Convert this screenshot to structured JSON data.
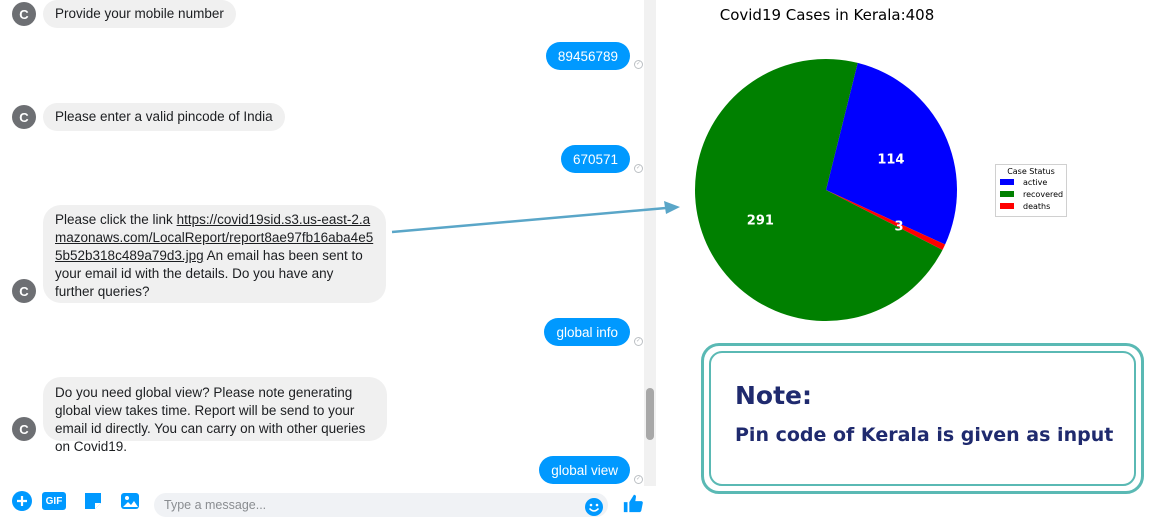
{
  "chat": {
    "avatar_letter": "C",
    "messages": [
      {
        "from": "bot",
        "text": "Provide your mobile number"
      },
      {
        "from": "user",
        "text": "89456789"
      },
      {
        "from": "bot",
        "text": "Please enter a valid pincode of India"
      },
      {
        "from": "user",
        "text": "670571"
      },
      {
        "from": "bot",
        "text_before": "Please click the link ",
        "link": "https://covid19sid.s3.us-east-2.amazonaws.com/LocalReport/report8ae97fb16aba4e55b52b318c489a79d3.jpg",
        "text_after": " An email has been sent to your email id with the details. Do you have any further queries?"
      },
      {
        "from": "user",
        "text": "global info"
      },
      {
        "from": "bot",
        "text": "Do you need global view? Please note generating global view takes time. Report will be send to your email id directly. You can carry on with other queries on Covid19."
      },
      {
        "from": "user",
        "text": "global view"
      }
    ],
    "composer": {
      "placeholder": "Type a message...",
      "gif_label": "GIF",
      "icons": [
        "plus-icon",
        "gif-icon",
        "sticker-icon",
        "image-icon",
        "emoji-icon",
        "like-icon"
      ]
    },
    "accent_color": "#0099ff"
  },
  "chart_data": {
    "type": "pie",
    "title": "Covid19 Cases in Kerala:408",
    "legend_title": "Case Status",
    "legend_placement": "right",
    "labels": [
      "active",
      "recovered",
      "deaths"
    ],
    "values": [
      114,
      291,
      3
    ],
    "colors": [
      "#0000ff",
      "#008000",
      "#ff0000"
    ]
  },
  "note": {
    "title": "Note:",
    "body": "Pin code of Kerala is given as input",
    "border_color": "#5ab9b4",
    "text_color": "#1f2a6e"
  }
}
